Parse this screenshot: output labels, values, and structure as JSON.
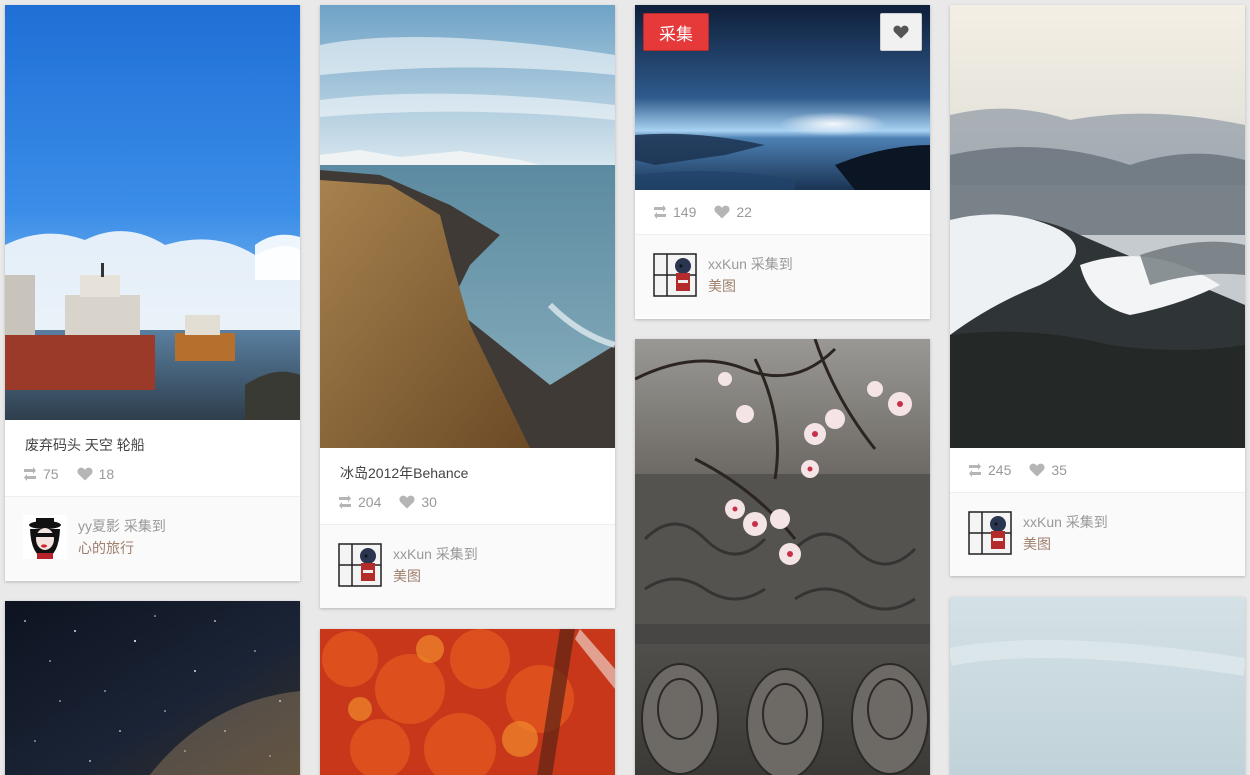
{
  "colors": {
    "background": "#e9e9e9",
    "save_button": "#e5393a",
    "board_link": "#9e7f6c",
    "stat_text": "#999999"
  },
  "overlay": {
    "save_label": "采集",
    "like_icon": "heart-icon"
  },
  "pins": [
    {
      "image": "abandoned dock with boats under blue sky",
      "caption": "废弃码头 天空 轮船",
      "repins": "75",
      "likes": "18",
      "user": "yy夏影",
      "action": "采集到",
      "board": "心的旅行"
    },
    {
      "image": "iceland coastline cliffs",
      "caption": "冰岛2012年Behance",
      "repins": "204",
      "likes": "30",
      "user": "xxKun",
      "action": "采集到",
      "board": "美图"
    },
    {
      "image": "blue planet horizon",
      "caption": "",
      "repins": "149",
      "likes": "22",
      "user": "xxKun",
      "action": "采集到",
      "board": "美图"
    },
    {
      "image": "misty snowy mountains",
      "caption": "",
      "repins": "245",
      "likes": "35",
      "user": "xxKun",
      "action": "采集到",
      "board": "美图"
    },
    {
      "image": "starry night sky"
    },
    {
      "image": "red autumn tree"
    },
    {
      "image": "plum blossoms over carved roof tiles"
    },
    {
      "image": "pale sky"
    }
  ]
}
